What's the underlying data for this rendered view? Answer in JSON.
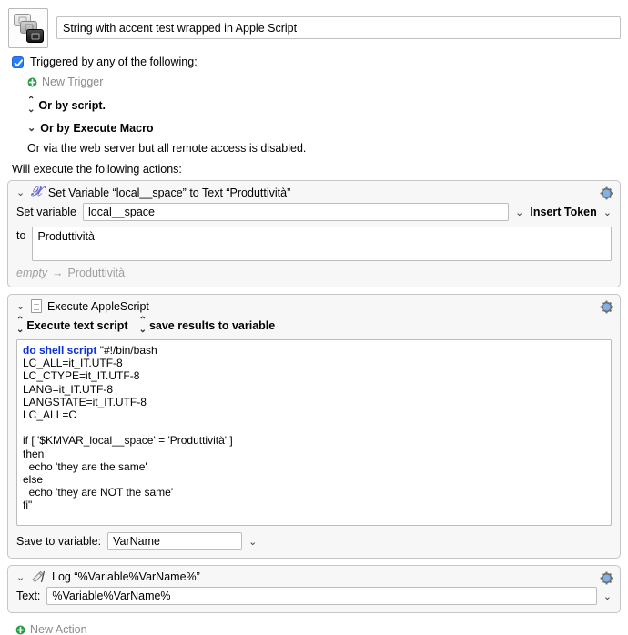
{
  "window": {
    "macro_title": "String with accent test wrapped in Apple Script",
    "macro_icon_name": "keyboard-keys-stack-icon"
  },
  "triggers": {
    "checkbox_label": "Triggered by any of the following:",
    "checkbox_checked": true,
    "new_trigger_label": "New Trigger",
    "or_by_script_label": "Or by script.",
    "or_by_execute_macro_label": "Or by Execute Macro",
    "web_server_note": "Or via the web server but all remote access is disabled."
  },
  "actions_header": "Will execute the following actions:",
  "actions": [
    {
      "title": "Set Variable “local__space” to Text “Produttività”",
      "icon": "set-variable-x-icon",
      "set_variable_label": "Set variable",
      "variable_name": "local__space",
      "insert_token_label": "Insert Token",
      "to_label": "to",
      "to_value": "Produttività",
      "result_before": "empty",
      "result_arrow": "→",
      "result_after": "Produttività"
    },
    {
      "title": "Execute AppleScript",
      "icon": "applescript-document-icon",
      "mode_execute_label": "Execute text script",
      "mode_results_label": "save results to variable",
      "script_keyword": "do shell script",
      "script_body": " \"#!/bin/bash\nLC_ALL=it_IT.UTF-8\nLC_CTYPE=it_IT.UTF-8\nLANG=it_IT.UTF-8\nLANGSTATE=it_IT.UTF-8\nLC_ALL=C\n\nif [ '$KMVAR_local__space' = 'Produttività' ]\nthen\n  echo 'they are the same'\nelse\n  echo 'they are NOT the same'\nfi\"",
      "save_to_variable_label": "Save to variable:",
      "save_to_variable_value": "VarName"
    },
    {
      "title": "Log “%Variable%VarName%”",
      "icon": "log-pencil-icon",
      "text_label": "Text:",
      "text_value": "%Variable%VarName%"
    }
  ],
  "new_action_label": "New Action",
  "colors": {
    "checkbox_blue": "#2a7cf7",
    "add_green": "#1f9d3d",
    "gear_blue": "#7fb3e8",
    "keyword_blue": "#0b2fd4",
    "variable_icon_purple": "#6c6cd8",
    "dim_gray": "#8b8b8b"
  }
}
